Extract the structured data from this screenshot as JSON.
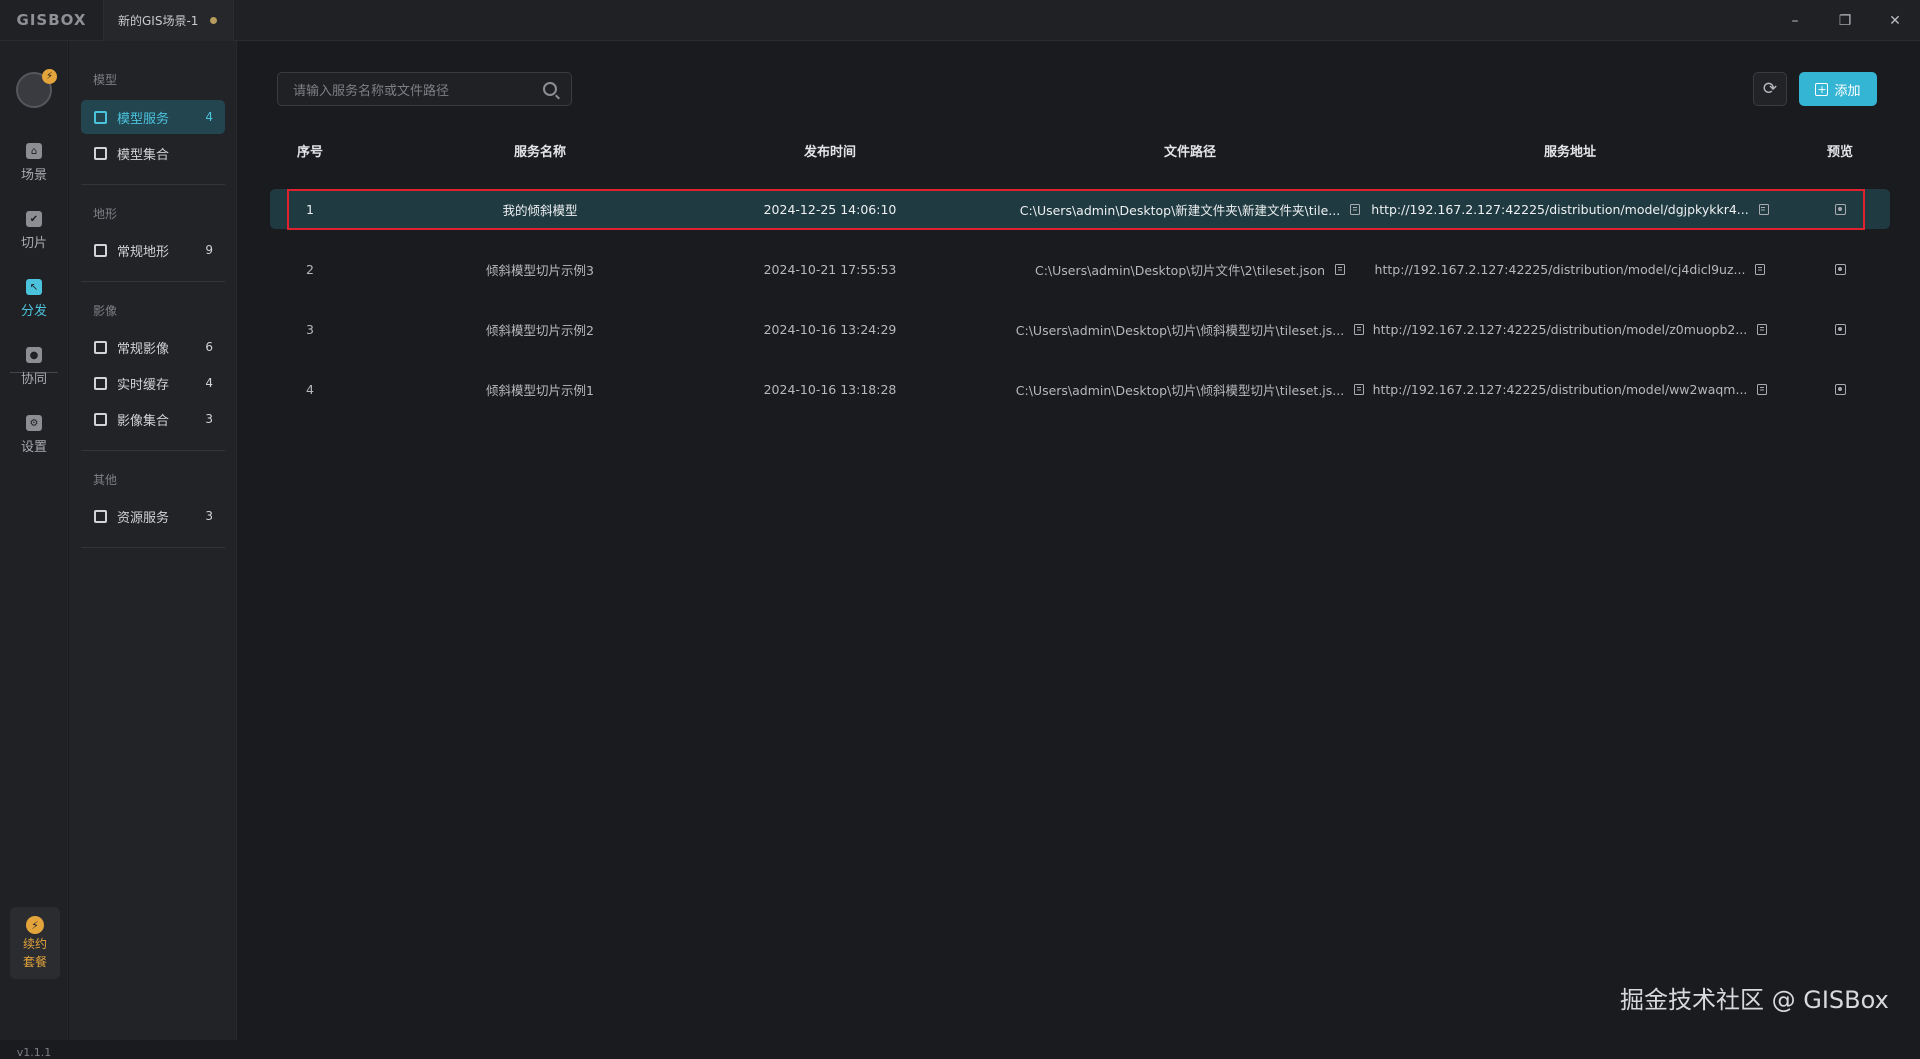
{
  "app": {
    "logo": "GISBOX",
    "tab_title": "新的GIS场景-1"
  },
  "window_controls": {
    "minimize": "–",
    "restore": "❐",
    "close": "✕"
  },
  "rail": {
    "avatar_badge": "⚡",
    "items": [
      {
        "label": "场景",
        "icon": "home-icon",
        "glyph": "⌂"
      },
      {
        "label": "切片",
        "icon": "slice-icon",
        "glyph": "✔"
      },
      {
        "label": "分发",
        "icon": "distribute-icon",
        "glyph": "↖"
      },
      {
        "label": "协同",
        "icon": "lock-icon",
        "glyph": "●"
      },
      {
        "label": "设置",
        "icon": "gear-icon",
        "glyph": "⚙"
      }
    ],
    "plan_label_1": "续约",
    "plan_label_2": "套餐",
    "plan_glyph": "⚡",
    "version": "v1.1.1"
  },
  "subnav": {
    "groups": [
      {
        "title": "模型",
        "items": [
          {
            "label": "模型服务",
            "count": "4"
          },
          {
            "label": "模型集合",
            "count": ""
          }
        ]
      },
      {
        "title": "地形",
        "items": [
          {
            "label": "常规地形",
            "count": "9"
          }
        ]
      },
      {
        "title": "影像",
        "items": [
          {
            "label": "常规影像",
            "count": "6"
          },
          {
            "label": "实时缓存",
            "count": "4"
          },
          {
            "label": "影像集合",
            "count": "3"
          }
        ]
      },
      {
        "title": "其他",
        "items": [
          {
            "label": "资源服务",
            "count": "3"
          }
        ]
      }
    ]
  },
  "toolbar": {
    "search_placeholder": "请输入服务名称或文件路径",
    "refresh_glyph": "⟳",
    "add_label": "添加",
    "add_glyph": "+"
  },
  "table": {
    "columns": [
      "序号",
      "服务名称",
      "发布时间",
      "文件路径",
      "服务地址",
      "预览"
    ],
    "rows": [
      {
        "index": "1",
        "name": "我的倾斜模型",
        "time": "2024-12-25 14:06:10",
        "path": "C:\\Users\\admin\\Desktop\\新建文件夹\\新建文件夹\\tile...",
        "url": "http://192.167.2.127:42225/distribution/model/dgjpkykkr4..."
      },
      {
        "index": "2",
        "name": "倾斜模型切片示例3",
        "time": "2024-10-21 17:55:53",
        "path": "C:\\Users\\admin\\Desktop\\切片文件\\2\\tileset.json",
        "url": "http://192.167.2.127:42225/distribution/model/cj4dicl9uz..."
      },
      {
        "index": "3",
        "name": "倾斜模型切片示例2",
        "time": "2024-10-16 13:24:29",
        "path": "C:\\Users\\admin\\Desktop\\切片\\倾斜模型切片\\tileset.js...",
        "url": "http://192.167.2.127:42225/distribution/model/z0muopb2..."
      },
      {
        "index": "4",
        "name": "倾斜模型切片示例1",
        "time": "2024-10-16 13:18:28",
        "path": "C:\\Users\\admin\\Desktop\\切片\\倾斜模型切片\\tileset.js...",
        "url": "http://192.167.2.127:42225/distribution/model/ww2waqm..."
      }
    ]
  },
  "watermark": "掘金技术社区 @ GISBox",
  "colors": {
    "accent": "#35b5d4",
    "highlight_border": "#e0222f",
    "plan": "#e3a43c"
  }
}
